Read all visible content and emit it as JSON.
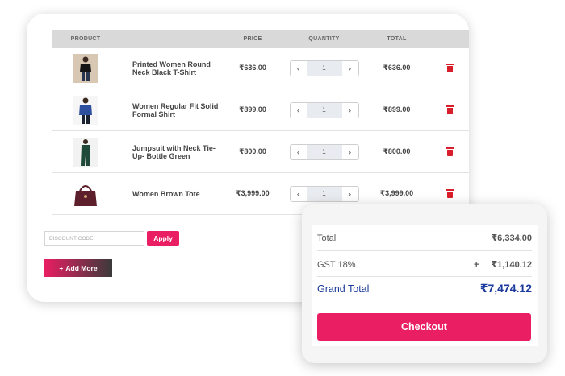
{
  "table": {
    "headers": {
      "product": "PRODUCT",
      "price": "PRICE",
      "quantity": "QUANTITY",
      "total": "TOTAL"
    },
    "rows": [
      {
        "name": "Printed Women Round Neck Black T-Shirt",
        "price": "₹636.00",
        "qty": "1",
        "total": "₹636.00",
        "image": "black-tshirt"
      },
      {
        "name": "Women Regular Fit Solid Formal Shirt",
        "price": "₹899.00",
        "qty": "1",
        "total": "₹899.00",
        "image": "blue-shirt"
      },
      {
        "name": "Jumpsuit with Neck Tie-Up- Bottle Green",
        "price": "₹800.00",
        "qty": "1",
        "total": "₹800.00",
        "image": "green-jumpsuit"
      },
      {
        "name": "Women Brown Tote",
        "price": "₹3,999.00",
        "qty": "1",
        "total": "₹3,999.00",
        "image": "brown-tote"
      }
    ]
  },
  "stepper": {
    "decrease": "‹",
    "increase": "›"
  },
  "discount": {
    "placeholder": "DISCOUNT CODE",
    "apply_label": "Apply"
  },
  "add_more": {
    "icon": "+",
    "label": "Add More"
  },
  "summary": {
    "total_label": "Total",
    "total_value": "₹6,334.00",
    "gst_label": "GST 18%",
    "gst_sign": "+",
    "gst_value": "₹1,140.12",
    "grand_label": "Grand Total",
    "grand_value": "₹7,474.12",
    "checkout_label": "Checkout"
  },
  "colors": {
    "accent": "#e91e63",
    "grand_total": "#1a3a9c",
    "delete": "#d81e2a",
    "header_bg": "#d9d9d9"
  }
}
